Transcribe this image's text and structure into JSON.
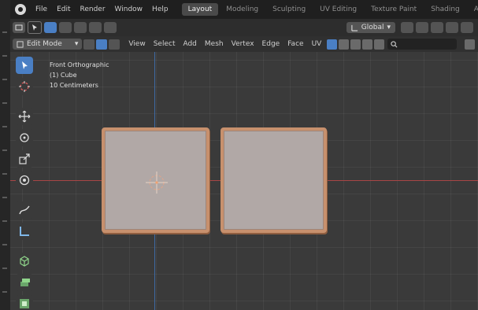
{
  "menu": [
    "File",
    "Edit",
    "Render",
    "Window",
    "Help"
  ],
  "workspace_tabs": [
    {
      "label": "Layout",
      "active": true
    },
    {
      "label": "Modeling",
      "active": false
    },
    {
      "label": "Sculpting",
      "active": false
    },
    {
      "label": "UV Editing",
      "active": false
    },
    {
      "label": "Texture Paint",
      "active": false
    },
    {
      "label": "Shading",
      "active": false
    },
    {
      "label": "Animation",
      "active": false
    }
  ],
  "toolbar": {
    "orientation": "Global"
  },
  "header": {
    "mode": "Edit Mode",
    "menus": [
      "View",
      "Select",
      "Add",
      "Mesh",
      "Vertex",
      "Edge",
      "Face",
      "UV"
    ],
    "search_icon": "search-icon"
  },
  "viewport": {
    "view_name": "Front Orthographic",
    "object": "(1) Cube",
    "scale": "10 Centimeters"
  },
  "colors": {
    "accent": "#4a7fc4",
    "x_axis": "#a84545",
    "y_axis": "#3f6aa3",
    "face": "#b1a8a6",
    "edge": "#c7906d"
  }
}
